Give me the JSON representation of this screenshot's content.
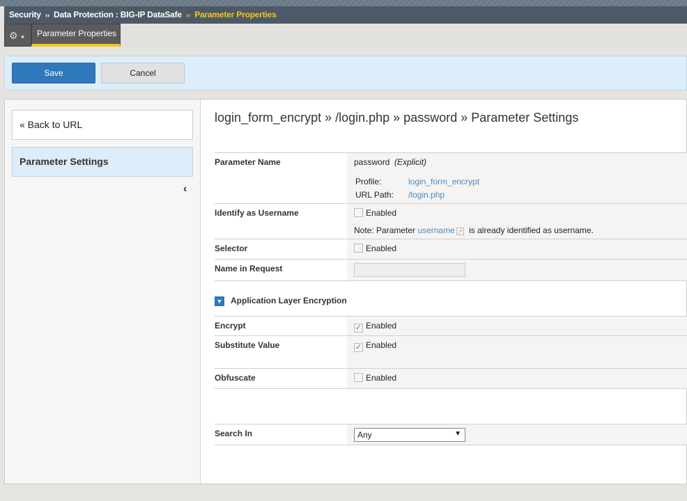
{
  "breadcrumb": {
    "items": [
      "Security",
      "Data Protection : BIG-IP DataSafe"
    ],
    "current": "Parameter Properties",
    "separator": "››"
  },
  "tabs": {
    "gear_icon": "gear-icon",
    "active": "Parameter Properties"
  },
  "toolbar": {
    "save": "Save",
    "cancel": "Cancel"
  },
  "sidebar": {
    "back": "« Back to URL",
    "item": "Parameter Settings",
    "collapse": "‹"
  },
  "main": {
    "title": "login_form_encrypt » /login.php » password » Parameter Settings",
    "parameter_name": {
      "label": "Parameter Name",
      "value": "password",
      "type": "(Explicit)",
      "profile_label": "Profile:",
      "profile": "login_form_encrypt",
      "url_label": "URL Path:",
      "url": "/login.php"
    },
    "identify": {
      "label": "Identify as Username",
      "checkbox": "Enabled",
      "checked": false,
      "note_pre": "Note: Parameter",
      "note_link": "username",
      "note_post": "is already identified as username."
    },
    "selector": {
      "label": "Selector",
      "checkbox": "Enabled",
      "checked": false
    },
    "name_in_request": {
      "label": "Name in Request",
      "value": ""
    },
    "section": "Application Layer Encryption",
    "encrypt": {
      "label": "Encrypt",
      "checkbox": "Enabled",
      "checked": true
    },
    "substitute": {
      "label": "Substitute Value",
      "checkbox": "Enabled",
      "checked": true
    },
    "obfuscate": {
      "label": "Obfuscate",
      "checkbox": "Enabled",
      "checked": false
    },
    "search_in": {
      "label": "Search In",
      "value": "Any"
    }
  }
}
